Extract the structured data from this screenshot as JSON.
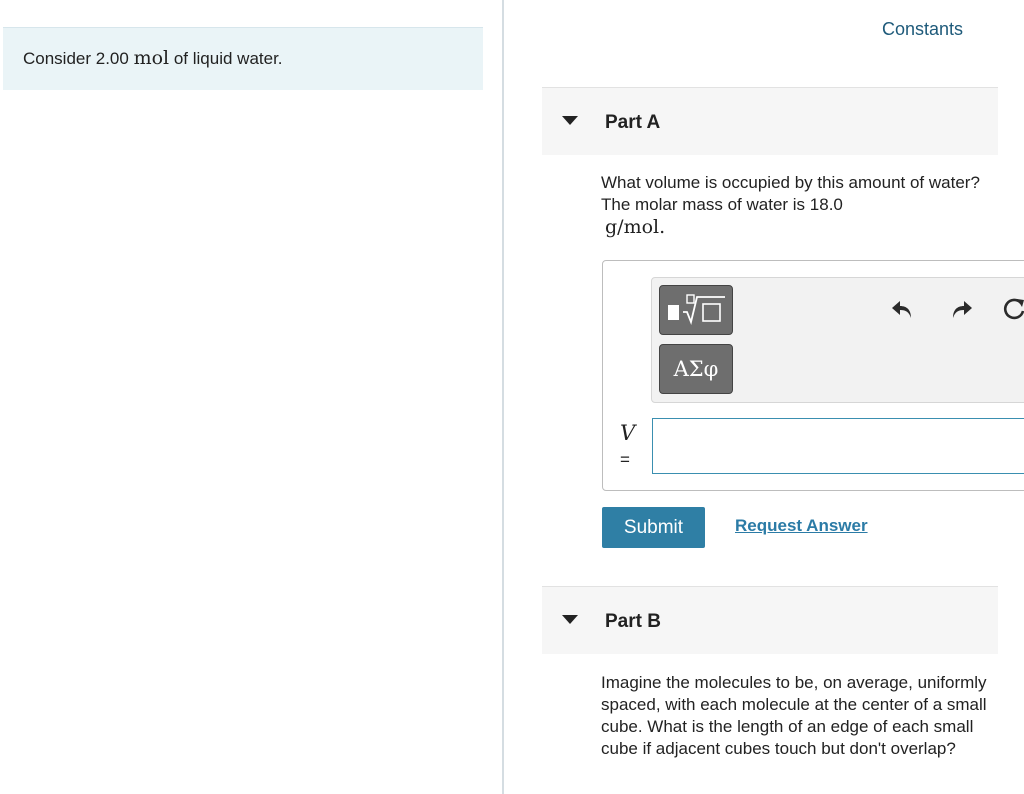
{
  "intro": {
    "prefix": "Consider 2.00 ",
    "unit": "mol",
    "suffix": " of liquid water."
  },
  "constants_link": "Constants",
  "part_a": {
    "title": "Part A",
    "question_text": "What volume is occupied by this amount of water? The molar mass of water is 18.0",
    "question_unit": "g/mol.",
    "toolbar": {
      "template_icon": "template-radical-icon",
      "greek_label": "ΑΣφ",
      "undo_icon": "undo-icon",
      "redo_icon": "redo-icon",
      "reset_icon": "reset-icon"
    },
    "variable": "V",
    "equals": "=",
    "answer_value": "",
    "submit_label": "Submit",
    "request_label": "Request Answer"
  },
  "part_b": {
    "title": "Part B",
    "question_text": "Imagine the molecules to be, on average, uniformly spaced, with each molecule at the center of a small cube. What is the length of an edge of each small cube if adjacent cubes touch but don't overlap?"
  }
}
